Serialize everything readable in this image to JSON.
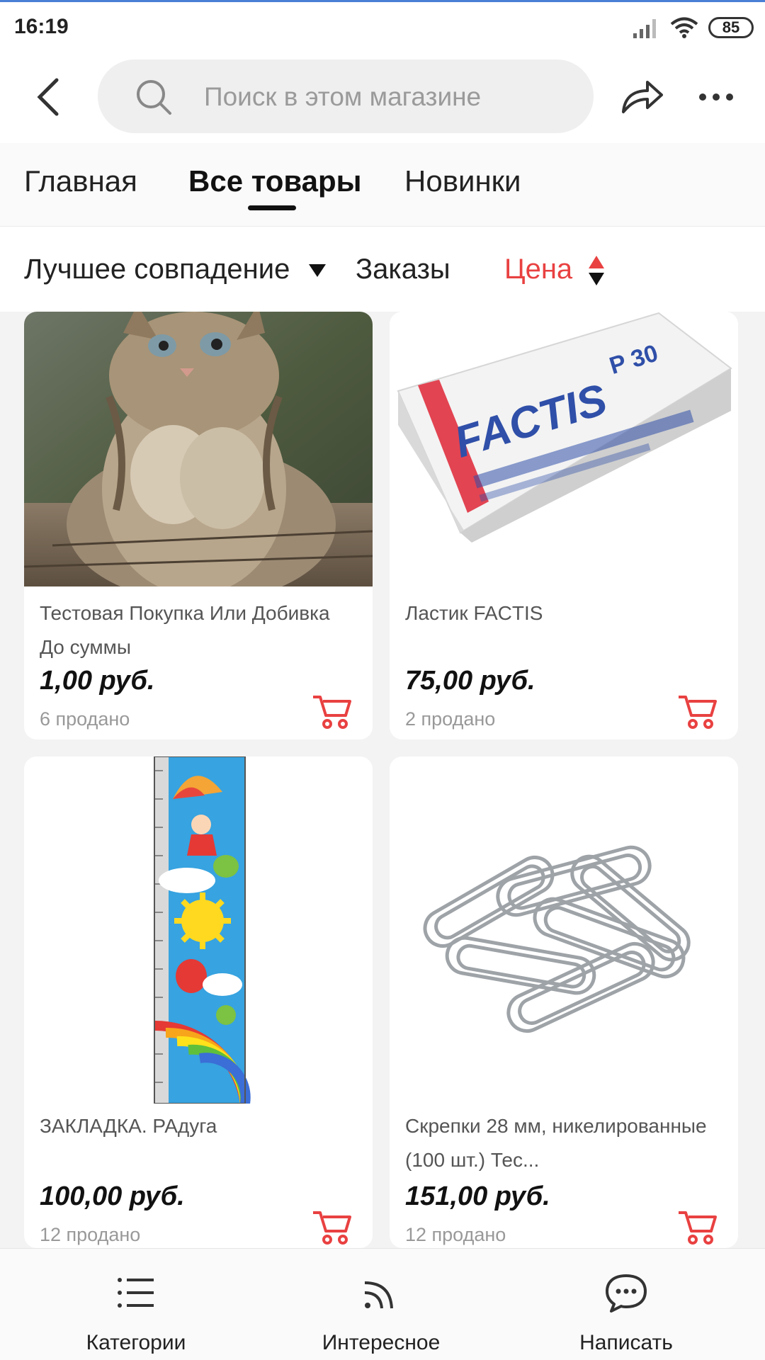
{
  "status_bar": {
    "time": "16:19",
    "battery": "85"
  },
  "search": {
    "placeholder": "Поиск в этом магазине"
  },
  "tabs": [
    {
      "label": "Главная"
    },
    {
      "label": "Все товары"
    },
    {
      "label": "Новинки"
    }
  ],
  "active_tab": "Все товары",
  "sort": {
    "best_match": "Лучшее совпадение",
    "orders": "Заказы",
    "price": "Цена"
  },
  "products": [
    {
      "title": "Тестовая Покупка Или Добивка До суммы",
      "price": "1,00 руб.",
      "sold": "6 продано",
      "icon": "kitten-photo"
    },
    {
      "title": "Ластик FACTIS",
      "price": "75,00 руб.",
      "sold": "2 продано",
      "icon": "eraser-photo",
      "brand": "FACTIS",
      "model": "P 30"
    },
    {
      "title": "ЗАКЛАДКА. РАдуга",
      "price": "100,00 руб.",
      "sold": "12 продано",
      "icon": "bookmark-photo"
    },
    {
      "title": "Скрепки  28 мм, никелированные (100 шт.) Тес...",
      "price": "151,00 руб.",
      "sold": "12 продано",
      "icon": "paperclips-photo"
    }
  ],
  "bottom_nav": [
    {
      "label": "Категории",
      "icon": "list-icon"
    },
    {
      "label": "Интересное",
      "icon": "feed-icon"
    },
    {
      "label": "Написать",
      "icon": "chat-icon"
    }
  ],
  "colors": {
    "accent": "#e94141",
    "status_accent": "#4a7fd6"
  }
}
